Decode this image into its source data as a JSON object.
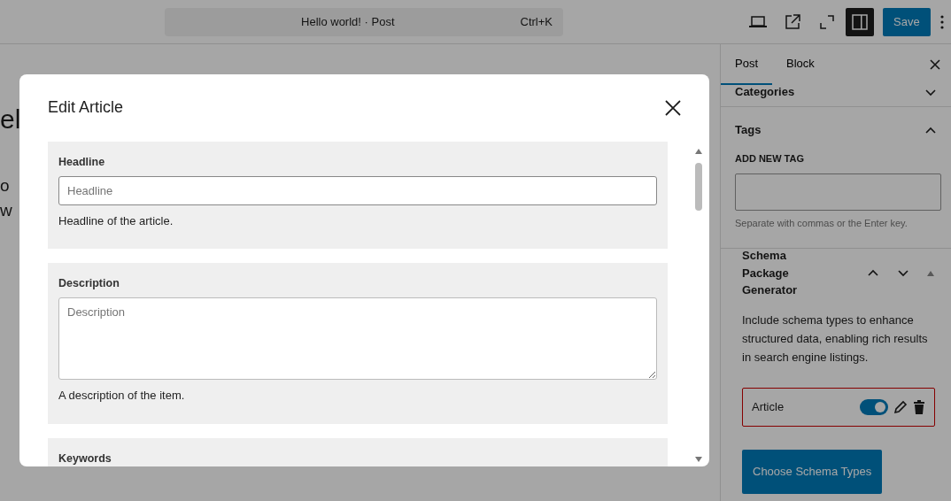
{
  "header": {
    "command_title": "Hello world! · Post",
    "shortcut": "Ctrl+K",
    "save": "Save"
  },
  "editor": {
    "fragments": [
      "el",
      "o",
      "w"
    ]
  },
  "sidebar": {
    "tabs": [
      {
        "label": "Post",
        "selected": true
      },
      {
        "label": "Block",
        "selected": false
      }
    ],
    "panels": [
      {
        "kind": "collapsible",
        "title": "Categories",
        "expanded": false
      },
      {
        "kind": "tags",
        "title": "Tags",
        "expanded": true,
        "field_label": "ADD NEW TAG",
        "help": "Separate with commas or the Enter key."
      },
      {
        "kind": "schema",
        "title": "Schema Package Generator",
        "description": "Include schema types to enhance structured data, enabling rich results in search engine listings.",
        "items": [
          {
            "name": "Article",
            "on": true
          }
        ],
        "button": "Choose Schema Types"
      }
    ]
  },
  "modal": {
    "title": "Edit Article",
    "fields": [
      {
        "kind": "input",
        "label": "Headline",
        "placeholder": "Headline",
        "help": "Headline of the article."
      },
      {
        "kind": "textarea",
        "label": "Description",
        "placeholder": "Description",
        "help": "A description of the item."
      },
      {
        "kind": "label_only",
        "label": "Keywords"
      }
    ]
  }
}
